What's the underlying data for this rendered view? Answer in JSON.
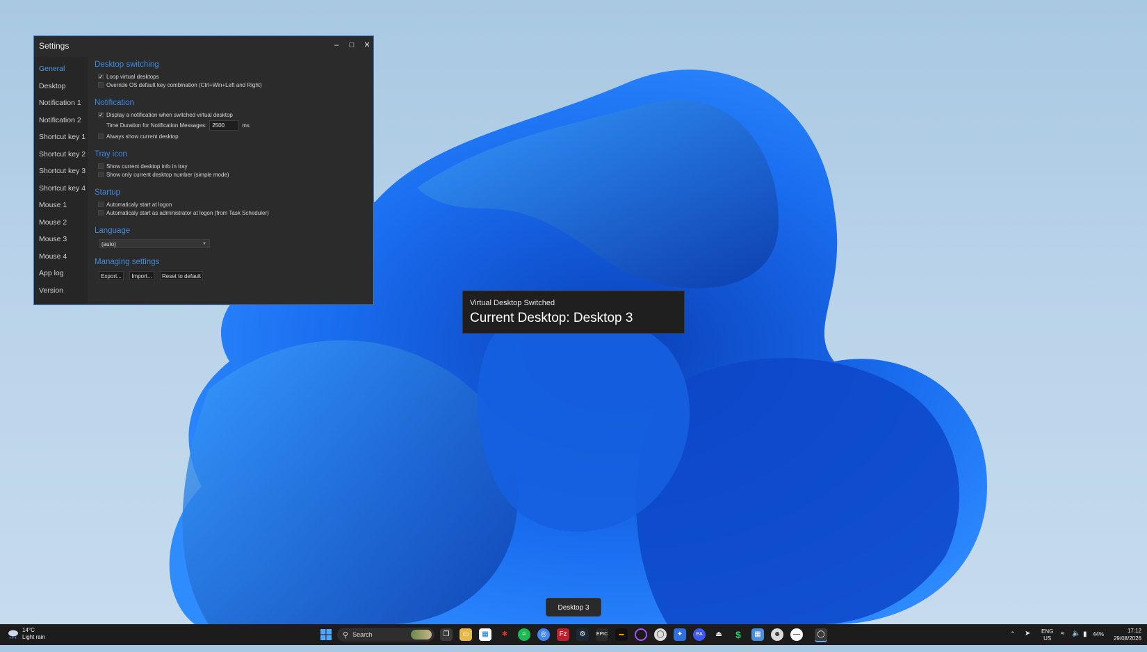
{
  "settings": {
    "title": "Settings",
    "sidebar": [
      "General",
      "Desktop",
      "Notification 1",
      "Notification 2",
      "Shortcut key 1",
      "Shortcut key 2",
      "Shortcut key 3",
      "Shortcut key 4",
      "Mouse 1",
      "Mouse 2",
      "Mouse 3",
      "Mouse 4",
      "App log",
      "Version"
    ],
    "sections": {
      "desktop_switching": "Desktop switching",
      "loop": "Loop virtual desktops",
      "override": "Override OS default key combination (Ctrl+Win+Left and Right)",
      "notification": "Notification",
      "display_notif": "Display a notification when switched virtual desktop",
      "duration_label": "Time Duration for Notification Messages:",
      "duration_value": "2500",
      "duration_unit": "ms",
      "always_show": "Always show current desktop",
      "tray_icon": "Tray icon",
      "tray_info": "Show current desktop info in tray",
      "tray_simple": "Show only current desktop number (simple mode)",
      "startup": "Startup",
      "start_logon": "Automaticaly start at logon",
      "start_admin": "Automaticaly start as administrator at logon (from Task Scheduler)",
      "language": "Language",
      "language_value": "(auto)",
      "managing": "Managing settings",
      "export": "Export...",
      "import": "Import...",
      "reset": "Reset to default"
    },
    "checked": {
      "loop": true,
      "override": false,
      "display_notif": true,
      "always_show": false,
      "tray_info": false,
      "tray_simple": false,
      "start_logon": false,
      "start_admin": false
    }
  },
  "notification": {
    "heading": "Virtual Desktop Switched",
    "message": "Current Desktop: Desktop 3"
  },
  "tooltip": "Desktop 3",
  "taskbar": {
    "temp": "14°C",
    "weather": "Light rain",
    "search_placeholder": "Search",
    "lang": "ENG",
    "region": "US",
    "battery": "44%",
    "time": "17:12",
    "date": "29/08/2026"
  },
  "colors": {
    "accent": "#3f8be0",
    "window_bg": "#2b2b2b",
    "taskbar_bg": "#1c1c1c"
  }
}
